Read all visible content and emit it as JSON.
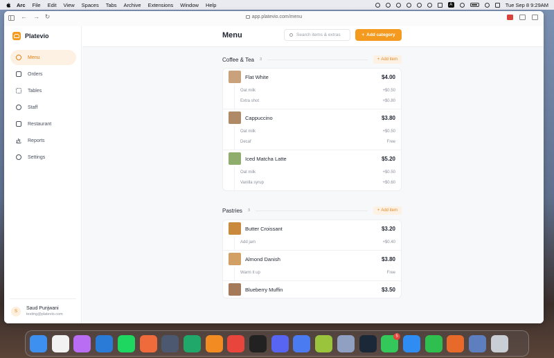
{
  "menubar": {
    "items": [
      "Arc",
      "File",
      "Edit",
      "View",
      "Spaces",
      "Tabs",
      "Archive",
      "Extensions",
      "Window",
      "Help"
    ],
    "clock": "Tue Sep 8  9:29AM"
  },
  "browser": {
    "url": "app.platevio.com/menu"
  },
  "sidebar": {
    "brand": "Platevio",
    "items": [
      {
        "label": "Menu",
        "icon": "menu-icon",
        "active": true
      },
      {
        "label": "Orders",
        "icon": "orders-icon"
      },
      {
        "label": "Tables",
        "icon": "tables-icon"
      },
      {
        "label": "Staff",
        "icon": "staff-icon"
      },
      {
        "label": "Restaurant",
        "icon": "restaurant-icon"
      },
      {
        "label": "Reports",
        "icon": "reports-icon"
      },
      {
        "label": "Settings",
        "icon": "settings-icon"
      }
    ],
    "user": {
      "initial": "S",
      "name": "Saud Punjwani",
      "email": "testing@platevio.com"
    }
  },
  "header": {
    "title": "Menu",
    "search_placeholder": "Search items & extras",
    "add_category": "Add category"
  },
  "accent": "#f39a1f",
  "sections": [
    {
      "title": "Coffee & Tea",
      "count": "3",
      "add_item": "Add item",
      "items": [
        {
          "name": "Flat White",
          "price": "$4.00",
          "thumb": "#c9a27c",
          "mods": [
            {
              "name": "Oat milk",
              "price": "+$0.50"
            },
            {
              "name": "Extra shot",
              "price": "+$0.80"
            }
          ]
        },
        {
          "name": "Cappuccino",
          "price": "$3.80",
          "thumb": "#b08a66",
          "mods": [
            {
              "name": "Oat milk",
              "price": "+$0.50"
            },
            {
              "name": "Decaf",
              "price": "Free"
            }
          ]
        },
        {
          "name": "Iced Matcha Latte",
          "price": "$5.20",
          "thumb": "#8fae6e",
          "mods": [
            {
              "name": "Oat milk",
              "price": "+$0.50"
            },
            {
              "name": "Vanilla syrup",
              "price": "+$0.60"
            }
          ]
        }
      ]
    },
    {
      "title": "Pastries",
      "count": "3",
      "add_item": "Add item",
      "items": [
        {
          "name": "Butter Croissant",
          "price": "$3.20",
          "thumb": "#c98a3e",
          "mods": [
            {
              "name": "Add jam",
              "price": "+$0.40"
            }
          ]
        },
        {
          "name": "Almond Danish",
          "price": "$3.80",
          "thumb": "#d2a064",
          "mods": [
            {
              "name": "Warm it up",
              "price": "Free"
            }
          ]
        },
        {
          "name": "Blueberry Muffin",
          "price": "$3.50",
          "thumb": "#a57a5a",
          "mods": []
        }
      ]
    }
  ],
  "dock": {
    "apps": [
      {
        "name": "finder-icon",
        "color": "#3d8ff0"
      },
      {
        "name": "chrome-icon",
        "color": "#f2f2f2"
      },
      {
        "name": "app-icon-purple",
        "color": "#b86df2"
      },
      {
        "name": "vscode-icon",
        "color": "#2a7ad8"
      },
      {
        "name": "spotify-icon",
        "color": "#1ed760"
      },
      {
        "name": "app-icon-orange",
        "color": "#ef6b3b"
      },
      {
        "name": "app-icon-dark",
        "color": "#4c5870"
      },
      {
        "name": "app-icon-green",
        "color": "#1fa86a"
      },
      {
        "name": "books-icon",
        "color": "#f28b22"
      },
      {
        "name": "app-icon-red",
        "color": "#e8453c"
      },
      {
        "name": "activity-icon",
        "color": "#222222"
      },
      {
        "name": "discord-icon",
        "color": "#5865f2"
      },
      {
        "name": "app-icon-blue",
        "color": "#4a7bf0"
      },
      {
        "name": "app-icon-lime",
        "color": "#9ac43c"
      },
      {
        "name": "app-icon-grey",
        "color": "#8fa0c2"
      },
      {
        "name": "steam-icon",
        "color": "#1b2838"
      },
      {
        "name": "messages-icon",
        "color": "#34c759",
        "badge": "5"
      },
      {
        "name": "safari-icon",
        "color": "#2f8cf2"
      },
      {
        "name": "numbers-icon",
        "color": "#2fbf4e"
      },
      {
        "name": "app-icon-rocket",
        "color": "#e86a2a"
      },
      {
        "name": "app-icon-cylinder",
        "color": "#5d7fc0"
      },
      {
        "name": "trash-icon",
        "color": "#c9cdd4"
      }
    ]
  }
}
